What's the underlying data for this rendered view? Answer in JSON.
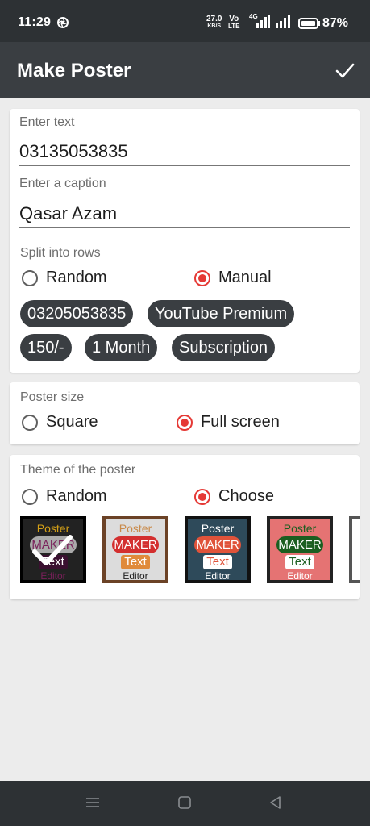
{
  "status": {
    "time": "11:29",
    "net_speed_top": "27.0",
    "net_speed_unit": "KB/S",
    "volte_top": "Vo",
    "volte_bottom": "LTE",
    "network": "4G",
    "battery_pct": "87%",
    "icons": [
      "aperture-icon",
      "signal-icon",
      "signal-icon",
      "battery-icon"
    ]
  },
  "appbar": {
    "title": "Make Poster",
    "confirm_icon": "check-icon"
  },
  "text_card": {
    "text_label": "Enter text",
    "text_value": "03135053835",
    "caption_label": "Enter a caption",
    "caption_value": "Qasar Azam",
    "split_label": "Split into rows",
    "split_options": [
      "Random",
      "Manual"
    ],
    "split_selected": "Manual",
    "chips": [
      "03205053835",
      "YouTube Premium",
      "150/-",
      "1 Month",
      "Subscription"
    ]
  },
  "size_card": {
    "label": "Poster size",
    "options": [
      "Square",
      "Full screen"
    ],
    "selected": "Full screen"
  },
  "theme_card": {
    "label": "Theme of the poster",
    "options": [
      "Random",
      "Choose"
    ],
    "selected": "Choose",
    "themes": [
      {
        "line1": "Poster",
        "line2": "MAKER",
        "line3": "Text",
        "line4": "Editor",
        "selected": true
      },
      {
        "line1": "Poster",
        "line2": "MAKER",
        "line3": "Text",
        "line4": "Editor",
        "selected": false
      },
      {
        "line1": "Poster",
        "line2": "MAKER",
        "line3": "Text",
        "line4": "Editor",
        "selected": false
      },
      {
        "line1": "Poster",
        "line2": "MAKER",
        "line3": "Text",
        "line4": "Editor",
        "selected": false
      }
    ],
    "colors": {
      "accent_red": "#e53935",
      "chip_bg": "#3a3e42"
    }
  },
  "navbar": {
    "icons": [
      "menu-icon",
      "home-icon",
      "back-icon"
    ]
  }
}
